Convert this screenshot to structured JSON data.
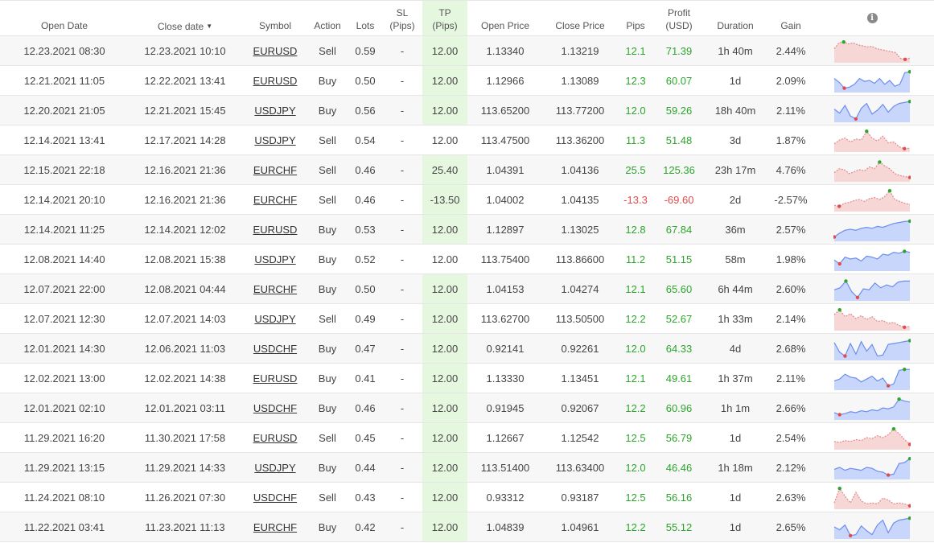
{
  "header": {
    "open_date": "Open Date",
    "close_date": "Close date",
    "sort_icon": "triangle-down-icon",
    "symbol": "Symbol",
    "action": "Action",
    "lots": "Lots",
    "sl_line1": "SL",
    "sl_line2": "(Pips)",
    "tp_line1": "TP",
    "tp_line2": "(Pips)",
    "open_price": "Open Price",
    "close_price": "Close Price",
    "pips": "Pips",
    "profit_line1": "Profit",
    "profit_line2": "(USD)",
    "duration": "Duration",
    "gain": "Gain",
    "info_icon": "i"
  },
  "colors": {
    "positive": "#2ca52c",
    "negative": "#e24b4b",
    "tp_highlight": "#e5f8df",
    "spark_buy_fill": "#c9d6fb",
    "spark_buy_line": "#6b8ef0",
    "spark_sell_fill": "#f7d6d6",
    "spark_sell_line": "#e08a8a"
  },
  "rows": [
    {
      "open": "12.23.2021 08:30",
      "close": "12.23.2021 10:10",
      "symbol": "EURUSD",
      "action": "Sell",
      "lots": "0.59",
      "sl": "-",
      "tp": "12.00",
      "tp_hl": true,
      "open_price": "1.13340",
      "close_price": "1.13219",
      "pips": "12.1",
      "profit": "71.39",
      "duration": "1h 40m",
      "gain": "2.44%",
      "positive": true,
      "spark": [
        0.6,
        0.9,
        0.95,
        0.85,
        0.9,
        0.8,
        0.75,
        0.7,
        0.72,
        0.6,
        0.55,
        0.5,
        0.45,
        0.4,
        0.1,
        0.05,
        0.12
      ]
    },
    {
      "open": "12.21.2021 11:05",
      "close": "12.22.2021 13:41",
      "symbol": "EURUSD",
      "action": "Buy",
      "lots": "0.50",
      "sl": "-",
      "tp": "12.00",
      "tp_hl": true,
      "open_price": "1.12966",
      "close_price": "1.13089",
      "pips": "12.3",
      "profit": "60.07",
      "duration": "1d",
      "gain": "2.09%",
      "positive": true,
      "spark": [
        0.6,
        0.4,
        0.1,
        0.15,
        0.3,
        0.6,
        0.45,
        0.5,
        0.35,
        0.6,
        0.3,
        0.5,
        0.2,
        0.3,
        0.9,
        0.95
      ]
    },
    {
      "open": "12.20.2021 21:05",
      "close": "12.21.2021 15:45",
      "symbol": "USDJPY",
      "action": "Buy",
      "lots": "0.56",
      "sl": "-",
      "tp": "12.00",
      "tp_hl": true,
      "open_price": "113.65200",
      "close_price": "113.77200",
      "pips": "12.0",
      "profit": "59.26",
      "duration": "18h 40m",
      "gain": "2.11%",
      "positive": true,
      "spark": [
        0.55,
        0.35,
        0.75,
        0.2,
        0.05,
        0.6,
        0.85,
        0.3,
        0.5,
        0.8,
        0.4,
        0.7,
        0.85,
        0.9,
        0.95
      ]
    },
    {
      "open": "12.14.2021 13:41",
      "close": "12.17.2021 14:28",
      "symbol": "USDJPY",
      "action": "Sell",
      "lots": "0.54",
      "sl": "-",
      "tp": "12.00",
      "tp_hl": false,
      "open_price": "113.47500",
      "close_price": "113.36200",
      "pips": "11.3",
      "profit": "51.48",
      "duration": "3d",
      "gain": "1.87%",
      "positive": true,
      "spark": [
        0.3,
        0.5,
        0.6,
        0.4,
        0.55,
        0.5,
        0.95,
        0.6,
        0.45,
        0.7,
        0.35,
        0.4,
        0.15,
        0.05,
        0.08
      ]
    },
    {
      "open": "12.15.2021 22:18",
      "close": "12.16.2021 21:36",
      "symbol": "EURCHF",
      "action": "Sell",
      "lots": "0.46",
      "sl": "-",
      "tp": "25.40",
      "tp_hl": true,
      "open_price": "1.04391",
      "close_price": "1.04136",
      "pips": "25.5",
      "profit": "125.36",
      "duration": "23h 17m",
      "gain": "4.76%",
      "positive": true,
      "spark": [
        0.35,
        0.55,
        0.5,
        0.3,
        0.4,
        0.5,
        0.45,
        0.65,
        0.55,
        0.9,
        0.7,
        0.55,
        0.3,
        0.2,
        0.15,
        0.1
      ]
    },
    {
      "open": "12.14.2021 20:10",
      "close": "12.16.2021 21:36",
      "symbol": "EURCHF",
      "action": "Sell",
      "lots": "0.46",
      "sl": "-",
      "tp": "-13.50",
      "tp_hl": true,
      "open_price": "1.04002",
      "close_price": "1.04135",
      "pips": "-13.3",
      "profit": "-69.60",
      "duration": "2d",
      "gain": "-2.57%",
      "positive": false,
      "spark": [
        0.2,
        0.15,
        0.3,
        0.35,
        0.45,
        0.5,
        0.4,
        0.55,
        0.6,
        0.5,
        0.65,
        0.95,
        0.5,
        0.4,
        0.3,
        0.25
      ]
    },
    {
      "open": "12.14.2021 11:25",
      "close": "12.14.2021 12:02",
      "symbol": "EURUSD",
      "action": "Buy",
      "lots": "0.53",
      "sl": "-",
      "tp": "12.00",
      "tp_hl": true,
      "open_price": "1.12897",
      "close_price": "1.13025",
      "pips": "12.8",
      "profit": "67.84",
      "duration": "36m",
      "gain": "2.57%",
      "positive": true,
      "spark": [
        0.1,
        0.3,
        0.45,
        0.5,
        0.45,
        0.55,
        0.6,
        0.55,
        0.65,
        0.6,
        0.7,
        0.8,
        0.85,
        0.9,
        0.92
      ]
    },
    {
      "open": "12.08.2021 14:40",
      "close": "12.08.2021 15:38",
      "symbol": "USDJPY",
      "action": "Buy",
      "lots": "0.52",
      "sl": "-",
      "tp": "12.00",
      "tp_hl": false,
      "open_price": "113.75400",
      "close_price": "113.86600",
      "pips": "11.2",
      "profit": "51.15",
      "duration": "58m",
      "gain": "1.98%",
      "positive": true,
      "spark": [
        0.45,
        0.25,
        0.6,
        0.5,
        0.55,
        0.4,
        0.65,
        0.6,
        0.5,
        0.75,
        0.7,
        0.85,
        0.8,
        0.9,
        0.85
      ]
    },
    {
      "open": "12.07.2021 22:00",
      "close": "12.08.2021 04:44",
      "symbol": "EURCHF",
      "action": "Buy",
      "lots": "0.50",
      "sl": "-",
      "tp": "12.00",
      "tp_hl": true,
      "open_price": "1.04153",
      "close_price": "1.04274",
      "pips": "12.1",
      "profit": "65.60",
      "duration": "6h 44m",
      "gain": "2.60%",
      "positive": true,
      "spark": [
        0.45,
        0.55,
        0.9,
        0.35,
        0.05,
        0.5,
        0.45,
        0.8,
        0.55,
        0.7,
        0.6,
        0.85,
        0.9,
        0.9
      ]
    },
    {
      "open": "12.07.2021 12:30",
      "close": "12.07.2021 14:03",
      "symbol": "USDJPY",
      "action": "Sell",
      "lots": "0.49",
      "sl": "-",
      "tp": "12.00",
      "tp_hl": true,
      "open_price": "113.62700",
      "close_price": "113.50500",
      "pips": "12.2",
      "profit": "52.67",
      "duration": "1h 33m",
      "gain": "2.14%",
      "positive": true,
      "spark": [
        0.7,
        0.95,
        0.6,
        0.75,
        0.5,
        0.65,
        0.45,
        0.6,
        0.35,
        0.4,
        0.25,
        0.3,
        0.15,
        0.05,
        0.1
      ]
    },
    {
      "open": "12.01.2021 14:30",
      "close": "12.06.2021 11:03",
      "symbol": "USDCHF",
      "action": "Buy",
      "lots": "0.47",
      "sl": "-",
      "tp": "12.00",
      "tp_hl": true,
      "open_price": "0.92141",
      "close_price": "0.92261",
      "pips": "12.0",
      "profit": "64.33",
      "duration": "4d",
      "gain": "2.68%",
      "positive": true,
      "spark": [
        0.8,
        0.3,
        0.1,
        0.75,
        0.2,
        0.85,
        0.35,
        0.7,
        0.1,
        0.15,
        0.7,
        0.75,
        0.8,
        0.85,
        0.9
      ]
    },
    {
      "open": "12.02.2021 13:00",
      "close": "12.02.2021 14:38",
      "symbol": "EURUSD",
      "action": "Buy",
      "lots": "0.41",
      "sl": "-",
      "tp": "12.00",
      "tp_hl": true,
      "open_price": "1.13330",
      "close_price": "1.13451",
      "pips": "12.1",
      "profit": "49.61",
      "duration": "1h 37m",
      "gain": "2.11%",
      "positive": true,
      "spark": [
        0.35,
        0.45,
        0.7,
        0.55,
        0.5,
        0.3,
        0.45,
        0.6,
        0.35,
        0.5,
        0.1,
        0.2,
        0.9,
        0.95,
        0.95
      ]
    },
    {
      "open": "12.01.2021 02:10",
      "close": "12.01.2021 03:11",
      "symbol": "USDCHF",
      "action": "Buy",
      "lots": "0.46",
      "sl": "-",
      "tp": "12.00",
      "tp_hl": true,
      "open_price": "0.91945",
      "close_price": "0.92067",
      "pips": "12.2",
      "profit": "60.96",
      "duration": "1h 1m",
      "gain": "2.66%",
      "positive": true,
      "spark": [
        0.25,
        0.15,
        0.2,
        0.3,
        0.25,
        0.35,
        0.3,
        0.4,
        0.35,
        0.5,
        0.45,
        0.55,
        0.95,
        0.85,
        0.8
      ]
    },
    {
      "open": "11.29.2021 16:20",
      "close": "11.30.2021 17:58",
      "symbol": "EURUSD",
      "action": "Sell",
      "lots": "0.45",
      "sl": "-",
      "tp": "12.00",
      "tp_hl": true,
      "open_price": "1.12667",
      "close_price": "1.12542",
      "pips": "12.5",
      "profit": "56.79",
      "duration": "1d",
      "gain": "2.54%",
      "positive": true,
      "spark": [
        0.3,
        0.25,
        0.35,
        0.3,
        0.4,
        0.35,
        0.5,
        0.45,
        0.6,
        0.5,
        0.65,
        0.95,
        0.7,
        0.4,
        0.15
      ]
    },
    {
      "open": "11.29.2021 13:15",
      "close": "11.29.2021 14:33",
      "symbol": "USDJPY",
      "action": "Buy",
      "lots": "0.44",
      "sl": "-",
      "tp": "12.00",
      "tp_hl": true,
      "open_price": "113.51400",
      "close_price": "113.63400",
      "pips": "12.0",
      "profit": "46.46",
      "duration": "1h 18m",
      "gain": "2.12%",
      "positive": true,
      "spark": [
        0.4,
        0.5,
        0.35,
        0.45,
        0.4,
        0.35,
        0.5,
        0.45,
        0.3,
        0.25,
        0.1,
        0.15,
        0.7,
        0.75,
        0.95
      ]
    },
    {
      "open": "11.24.2021 08:10",
      "close": "11.26.2021 07:30",
      "symbol": "USDCHF",
      "action": "Sell",
      "lots": "0.43",
      "sl": "-",
      "tp": "12.00",
      "tp_hl": true,
      "open_price": "0.93312",
      "close_price": "0.93187",
      "pips": "12.5",
      "profit": "56.16",
      "duration": "1d",
      "gain": "2.63%",
      "positive": true,
      "spark": [
        0.2,
        0.95,
        0.55,
        0.2,
        0.75,
        0.3,
        0.15,
        0.2,
        0.15,
        0.45,
        0.35,
        0.15,
        0.2,
        0.15,
        0.05
      ]
    },
    {
      "open": "11.22.2021 03:41",
      "close": "11.23.2021 11:13",
      "symbol": "EURCHF",
      "action": "Buy",
      "lots": "0.42",
      "sl": "-",
      "tp": "12.00",
      "tp_hl": true,
      "open_price": "1.04839",
      "close_price": "1.04961",
      "pips": "12.2",
      "profit": "55.12",
      "duration": "1d",
      "gain": "2.65%",
      "positive": true,
      "spark": [
        0.5,
        0.35,
        0.6,
        0.05,
        0.1,
        0.55,
        0.3,
        0.1,
        0.6,
        0.85,
        0.2,
        0.7,
        0.85,
        0.9,
        0.95
      ]
    }
  ]
}
